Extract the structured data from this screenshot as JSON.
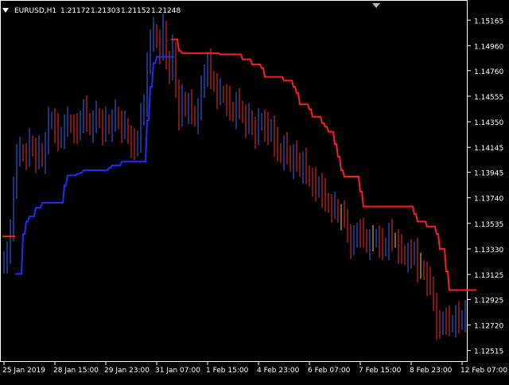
{
  "header": {
    "symbol_label": "EURUSD,H1",
    "ohlc": [
      "1.21172",
      "1.21303",
      "1.21152",
      "1.21248"
    ]
  },
  "colors": {
    "background": "#000000",
    "frame": "#ffffff",
    "text": "#ffffff",
    "candle_up": "#2b6bff",
    "candle_down": "#ff2a2a",
    "doji": "#f2d92a",
    "red_line": "#ff1e1e",
    "blue_line": "#1f2dff"
  },
  "chart_data": {
    "type": "line",
    "ylim": [
      1.1243,
      1.1532
    ],
    "ytick_labels": [
      "1.15165",
      "1.14960",
      "1.14760",
      "1.14555",
      "1.14350",
      "1.14145",
      "1.13945",
      "1.13740",
      "1.13535",
      "1.13330",
      "1.13125",
      "1.12925",
      "1.12720",
      "1.12515"
    ],
    "xtick_labels": [
      "25 Jan 2019",
      "28 Jan 15:00",
      "29 Jan 23:00",
      "31 Jan 07:00",
      "1 Feb 15:00",
      "4 Feb 23:00",
      "6 Feb 07:00",
      "7 Feb 15:00",
      "8 Feb 23:00",
      "12 Feb 07:00"
    ],
    "x_range_bars": [
      0,
      147
    ],
    "xtick_bars": [
      0,
      16,
      32,
      48,
      64,
      80,
      96,
      112,
      128,
      144
    ],
    "series": [
      {
        "kind": "candles",
        "close": [
          1.1325,
          1.133,
          1.1345,
          1.1385,
          1.1408,
          1.1411,
          1.1409,
          1.1408,
          1.1418,
          1.1413,
          1.1406,
          1.1412,
          1.1405,
          1.1418,
          1.1435,
          1.1437,
          1.143,
          1.142,
          1.1425,
          1.1432,
          1.1435,
          1.1432,
          1.143,
          1.1426,
          1.1438,
          1.1444,
          1.1436,
          1.143,
          1.1435,
          1.144,
          1.1436,
          1.1428,
          1.1435,
          1.1431,
          1.1436,
          1.1441,
          1.1435,
          1.143,
          1.1432,
          1.1423,
          1.1418,
          1.1413,
          1.1422,
          1.1441,
          1.1445,
          1.1485,
          1.15,
          1.1507,
          1.15,
          1.1493,
          1.151,
          1.1483,
          1.1477,
          1.1493,
          1.146,
          1.144,
          1.1453,
          1.1445,
          1.1449,
          1.1442,
          1.1437,
          1.1445,
          1.146,
          1.1475,
          1.1482,
          1.147,
          1.1465,
          1.1457,
          1.1458,
          1.1456,
          1.1452,
          1.1445,
          1.1441,
          1.145,
          1.1446,
          1.144,
          1.1434,
          1.1438,
          1.143,
          1.1425,
          1.1434,
          1.1436,
          1.1431,
          1.1425,
          1.1431,
          1.1419,
          1.1412,
          1.1408,
          1.1415,
          1.141,
          1.1401,
          1.1408,
          1.1404,
          1.1397,
          1.1402,
          1.1394,
          1.1389,
          1.1387,
          1.138,
          1.1385,
          1.1378,
          1.1372,
          1.1368,
          1.1366,
          1.1367,
          1.136,
          1.136,
          1.1359,
          1.1344,
          1.1337,
          1.134,
          1.1348,
          1.1346,
          1.1343,
          1.1336,
          1.134,
          1.134,
          1.1343,
          1.1338,
          1.1333,
          1.1336,
          1.1345,
          1.134,
          1.134,
          1.1333,
          1.133,
          1.1326,
          1.1329,
          1.1326,
          1.1333,
          1.1318,
          1.1318,
          1.1314,
          1.1307,
          1.1305,
          1.1289,
          1.1272,
          1.127,
          1.1277,
          1.1276,
          1.1272,
          1.1274,
          1.1279,
          1.1274,
          1.1278,
          1.1283
        ]
      },
      {
        "kind": "line",
        "color_key": "red_line",
        "values": [
          1.1343,
          1.1343,
          1.1343,
          1.1343,
          null,
          null,
          null,
          null,
          null,
          null,
          null,
          null,
          null,
          null,
          null,
          null,
          null,
          null,
          null,
          null,
          null,
          null,
          null,
          null,
          null,
          null,
          null,
          null,
          null,
          null,
          null,
          null,
          null,
          null,
          null,
          null,
          null,
          null,
          null,
          null,
          null,
          null,
          null,
          null,
          null,
          null,
          null,
          null,
          null,
          null,
          null,
          null,
          null,
          1.1501,
          1.1501,
          1.1492,
          1.149,
          1.149,
          1.149,
          1.149,
          1.149,
          1.149,
          1.149,
          1.149,
          1.149,
          1.149,
          1.149,
          1.149,
          1.1489,
          1.1489,
          1.1489,
          1.1489,
          1.1489,
          1.1489,
          1.1489,
          1.1485,
          1.1485,
          1.1485,
          1.1481,
          1.1481,
          1.1481,
          1.1478,
          1.1471,
          1.1471,
          1.1471,
          1.1471,
          1.1471,
          1.1471,
          1.1468,
          1.1468,
          1.1468,
          1.1463,
          1.1458,
          1.1449,
          1.1449,
          1.1449,
          1.1445,
          1.1439,
          1.1439,
          1.1439,
          1.1434,
          1.1431,
          1.1427,
          1.1427,
          1.1417,
          1.1407,
          1.1396,
          1.1391,
          1.1391,
          1.1391,
          1.1391,
          1.1391,
          1.1379,
          1.1367,
          1.1367,
          1.1367,
          1.1367,
          1.1367,
          1.1367,
          1.1367,
          1.1367,
          1.1367,
          1.1367,
          1.1367,
          1.1367,
          1.1367,
          1.1367,
          1.1367,
          1.1367,
          1.1361,
          1.1355,
          1.1355,
          1.1355,
          1.1351,
          1.1351,
          1.1351,
          1.1345,
          1.1333,
          1.1333,
          1.1315,
          1.13,
          1.13,
          1.13,
          1.13,
          1.13,
          1.13,
          1.13,
          1.13,
          1.13
        ]
      },
      {
        "kind": "line",
        "color_key": "blue_line",
        "values": [
          null,
          null,
          null,
          null,
          1.1313,
          1.1313,
          1.1345,
          1.1355,
          1.1359,
          1.1359,
          1.1366,
          1.1366,
          1.137,
          1.137,
          1.137,
          1.137,
          1.137,
          1.137,
          1.137,
          1.1384,
          1.1392,
          1.1392,
          1.1392,
          1.1393,
          1.1394,
          1.1396,
          1.1396,
          1.1396,
          1.1396,
          1.1396,
          1.1396,
          1.1396,
          1.1396,
          1.1398,
          1.14,
          1.14,
          1.14,
          1.1403,
          1.1403,
          1.1403,
          1.1403,
          1.1403,
          1.1403,
          1.1403,
          1.1403,
          1.1436,
          1.1463,
          1.1482,
          1.1487,
          1.1487,
          1.1487,
          1.1487,
          1.1487,
          1.1487,
          null,
          null,
          null,
          null,
          null,
          null,
          null,
          null,
          null,
          null,
          null,
          null,
          null,
          null,
          null,
          null,
          null,
          null,
          null,
          null,
          null,
          null,
          null,
          null,
          null,
          null,
          null,
          null,
          null,
          null,
          null,
          null,
          null,
          null,
          null,
          null,
          null,
          null,
          null,
          null,
          null,
          null,
          null,
          null,
          null,
          null,
          null,
          null,
          null,
          null,
          null,
          null,
          null,
          null,
          null,
          null,
          null,
          null,
          null,
          null,
          null,
          null,
          null,
          null,
          null,
          null,
          null,
          null,
          null,
          null,
          null,
          null,
          null,
          null,
          null,
          null,
          null,
          null,
          null,
          null,
          null,
          null,
          null,
          null,
          null,
          null,
          null,
          null,
          null,
          null,
          null,
          null,
          null,
          null,
          null,
          null,
          null
        ]
      }
    ],
    "grid": false,
    "legend": "none"
  }
}
